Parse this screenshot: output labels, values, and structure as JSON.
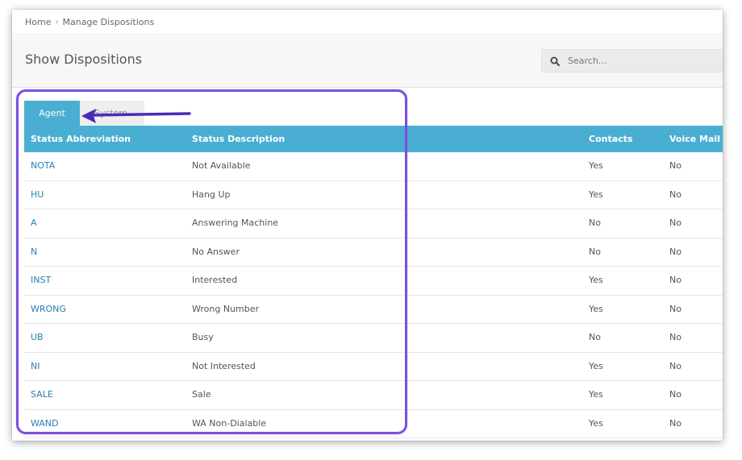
{
  "breadcrumb": {
    "home": "Home",
    "current": "Manage Dispositions"
  },
  "header": {
    "title": "Show Dispositions"
  },
  "search": {
    "placeholder": "Search..."
  },
  "tabs": [
    {
      "label": "Agent",
      "active": true
    },
    {
      "label": "System",
      "active": false
    }
  ],
  "table": {
    "columns": [
      "Status Abbreviation",
      "Status Description",
      "Contacts",
      "Voice Mail"
    ],
    "rows": [
      {
        "abbr": "NOTA",
        "desc": "Not Available",
        "contacts": "Yes",
        "voicemail": "No"
      },
      {
        "abbr": "HU",
        "desc": "Hang Up",
        "contacts": "Yes",
        "voicemail": "No"
      },
      {
        "abbr": "A",
        "desc": "Answering Machine",
        "contacts": "No",
        "voicemail": "No"
      },
      {
        "abbr": "N",
        "desc": "No Answer",
        "contacts": "No",
        "voicemail": "No"
      },
      {
        "abbr": "INST",
        "desc": "Interested",
        "contacts": "Yes",
        "voicemail": "No"
      },
      {
        "abbr": "WRONG",
        "desc": "Wrong Number",
        "contacts": "Yes",
        "voicemail": "No"
      },
      {
        "abbr": "UB",
        "desc": "Busy",
        "contacts": "No",
        "voicemail": "No"
      },
      {
        "abbr": "NI",
        "desc": "Not Interested",
        "contacts": "Yes",
        "voicemail": "No"
      },
      {
        "abbr": "SALE",
        "desc": "Sale",
        "contacts": "Yes",
        "voicemail": "No"
      },
      {
        "abbr": "WAND",
        "desc": "WA Non-Dialable",
        "contacts": "Yes",
        "voicemail": "No"
      }
    ]
  },
  "colors": {
    "accent": "#4aaed3",
    "link": "#2a7fb1",
    "annotation": "#7b4fe0"
  },
  "icons": {
    "search": "search-icon",
    "breadcrumb_separator": "chevron-right-icon",
    "annotation_arrow": "arrow-left-icon"
  }
}
